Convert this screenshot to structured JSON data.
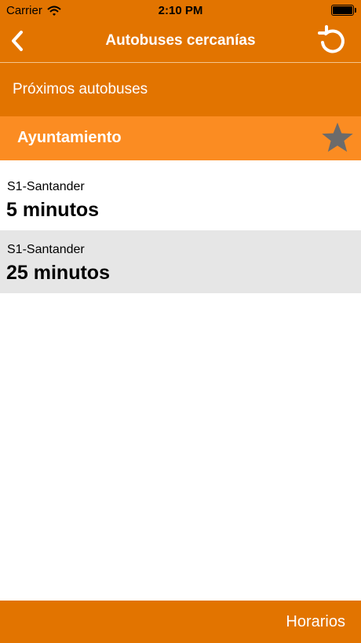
{
  "status_bar": {
    "carrier": "Carrier",
    "time": "2:10 PM",
    "icons": [
      "wifi-icon",
      "battery-icon"
    ]
  },
  "nav": {
    "title": "Autobuses cercanías",
    "back_icon": "chevron-left-icon",
    "refresh_icon": "refresh-icon"
  },
  "section": {
    "title": "Próximos autobuses"
  },
  "stop": {
    "name": "Ayuntamiento",
    "favorite_icon": "star-icon"
  },
  "arrivals": [
    {
      "line": "S1-Santander",
      "eta": "5 minutos"
    },
    {
      "line": "S1-Santander",
      "eta": "25 minutos"
    }
  ],
  "footer": {
    "button_label": "Horarios"
  },
  "colors": {
    "primary": "#e27400",
    "accent": "#fb8c22",
    "row_alt": "#e6e6e6",
    "star": "#6b6b6b"
  }
}
